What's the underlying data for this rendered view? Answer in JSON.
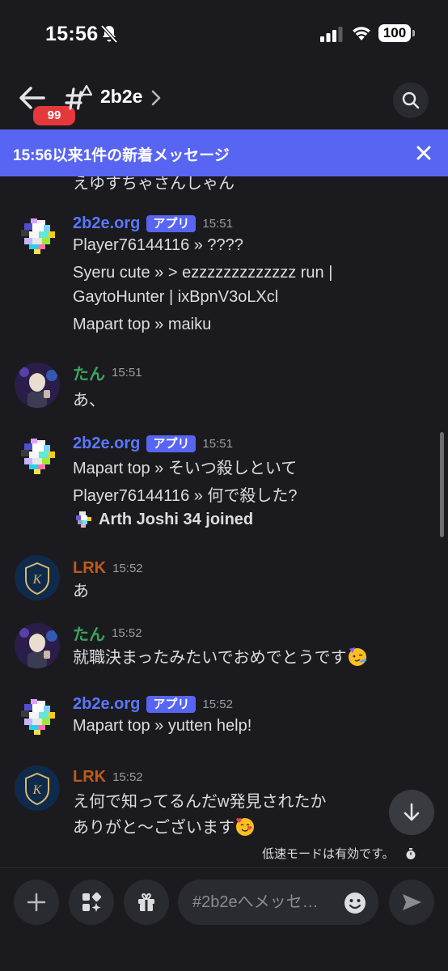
{
  "status_bar": {
    "time": "15:56",
    "battery": "100"
  },
  "header": {
    "back_badge": "99",
    "channel_name": "2b2e"
  },
  "banner": {
    "text": "15:56以来1件の新着メッセージ"
  },
  "cut_line": "えゆすちゃさんしゃん",
  "app_tag": "アプリ",
  "messages": [
    {
      "author": "2b2e.org",
      "time": "15:51",
      "lines": [
        "Player76144116 » ????",
        "Syeru cute » > ezzzzzzzzzzzzz run |",
        "GaytoHunter | ixBpnV3oLXcl",
        "Mapart top » maiku"
      ]
    },
    {
      "author": "たん",
      "time": "15:51",
      "lines": [
        "あ、"
      ]
    },
    {
      "author": "2b2e.org",
      "time": "15:51",
      "lines": [
        "Mapart top » そいつ殺しといて",
        "Player76144116 » 何で殺した?"
      ],
      "join": "Arth Joshi 34 joined"
    },
    {
      "author": "LRK",
      "time": "15:52",
      "lines": [
        "あ"
      ]
    },
    {
      "author": "たん",
      "time": "15:52",
      "lines": [
        "就職決まったみたいでおめでとうです"
      ]
    },
    {
      "author": "2b2e.org",
      "time": "15:52",
      "lines": [
        "Mapart top » yutten help!"
      ]
    },
    {
      "author": "LRK",
      "time": "15:52",
      "lines": [
        "え何で知ってるんだw発見されたか",
        "ありがと〜ございます"
      ]
    }
  ],
  "slowmode": "低速モードは有効です。",
  "composer": {
    "placeholder": "#2b2eへメッセ…"
  },
  "colors": {
    "accent": "#5865f2",
    "bot_name": "#5a77ff",
    "tan_name": "#3ba55c",
    "lrk_name": "#c15a18",
    "badge": "#e5383b"
  }
}
